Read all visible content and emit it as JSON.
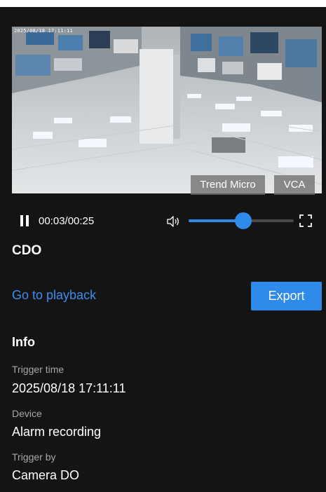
{
  "video": {
    "timestamp": "2025/08/18 17:11:11",
    "overlay_tags": [
      "Trend Micro",
      "VCA"
    ]
  },
  "player": {
    "time_display": "00:03/00:25",
    "volume_level": 0.52,
    "pause_icon": "pause-icon",
    "volume_icon": "volume-icon",
    "fullscreen_icon": "fullscreen-icon"
  },
  "event": {
    "title": "CDO",
    "playback_link": "Go to playback",
    "export_label": "Export"
  },
  "info": {
    "heading": "Info",
    "fields": [
      {
        "label": "Trigger time",
        "value": "2025/08/18 17:11:11"
      },
      {
        "label": "Device",
        "value": "Alarm recording"
      },
      {
        "label": "Trigger by",
        "value": "Camera DO"
      }
    ]
  },
  "colors": {
    "background": "#141414",
    "accent": "#2f8ae9",
    "link": "#3b8ef0",
    "label": "#a8a8a8"
  }
}
